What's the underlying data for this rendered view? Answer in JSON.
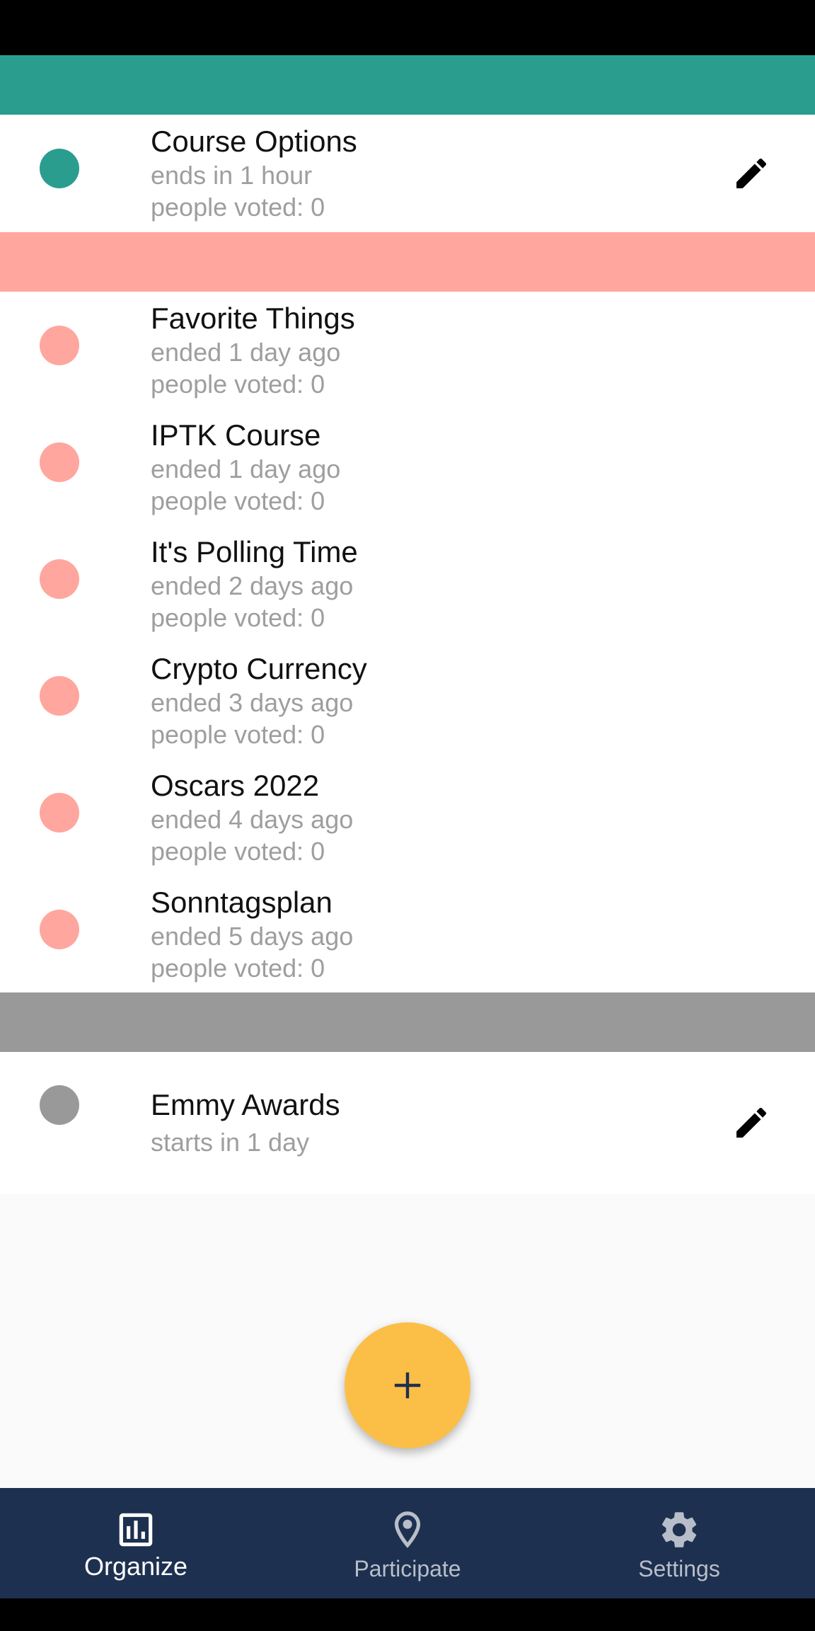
{
  "colors": {
    "active": "#2a9d8f",
    "ended": "#ffa69e",
    "upcoming": "#999999",
    "fab": "#fbbf47",
    "bottom_nav": "#1e3050"
  },
  "sections": {
    "active": {
      "polls": [
        {
          "title": "Course Options",
          "time": "ends in 1 hour",
          "votes": "people voted: 0",
          "editable": true
        }
      ]
    },
    "ended": {
      "polls": [
        {
          "title": "Favorite Things",
          "time": "ended 1 day ago",
          "votes": "people voted: 0"
        },
        {
          "title": "IPTK Course",
          "time": "ended 1 day ago",
          "votes": "people voted: 0"
        },
        {
          "title": "It's Polling Time",
          "time": "ended 2 days ago",
          "votes": "people voted: 0"
        },
        {
          "title": "Crypto Currency",
          "time": "ended 3 days ago",
          "votes": "people voted: 0"
        },
        {
          "title": "Oscars 2022",
          "time": "ended 4 days ago",
          "votes": "people voted: 0"
        },
        {
          "title": "Sonntagsplan",
          "time": "ended 5 days ago",
          "votes": "people voted: 0"
        }
      ]
    },
    "upcoming": {
      "polls": [
        {
          "title": "Emmy Awards",
          "time": "starts in 1 day",
          "editable": true
        }
      ]
    }
  },
  "fab": {
    "icon": "plus-icon",
    "symbol": "+"
  },
  "bottom_nav": {
    "items": [
      {
        "label": "Organize",
        "icon": "bar-chart-icon",
        "active": true
      },
      {
        "label": "Participate",
        "icon": "location-pin-icon",
        "active": false
      },
      {
        "label": "Settings",
        "icon": "gear-icon",
        "active": false
      }
    ]
  }
}
